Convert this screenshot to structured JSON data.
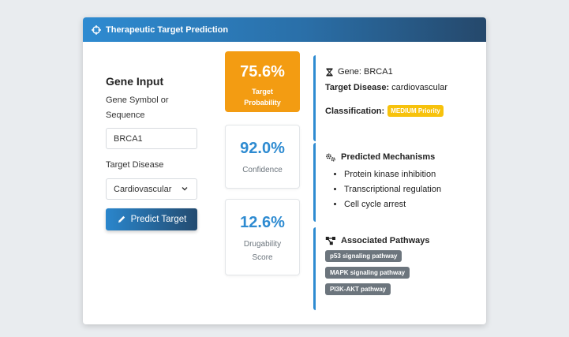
{
  "header": {
    "title": "Therapeutic Target Prediction",
    "icon": "crosshair-icon"
  },
  "input": {
    "title": "Gene Input",
    "symbol_label": "Gene Symbol or Sequence",
    "symbol_value": "BRCA1",
    "disease_label": "Target Disease",
    "disease_value": "Cardiovascular",
    "predict_label": "Predict Target"
  },
  "metrics": [
    {
      "value": "75.6%",
      "label": "Target Probability",
      "color": "#f39c12"
    },
    {
      "value": "92.0%",
      "label": "Confidence",
      "color": "#2e8bd1"
    },
    {
      "value": "12.6%",
      "label": "Drugability Score",
      "color": "#2e8bd1"
    }
  ],
  "target": {
    "gene_text": "Gene: BRCA1",
    "disease_label": "Target Disease:",
    "disease_value": "cardiovascular",
    "classification_label": "Classification:",
    "classification_value": "MEDIUM Priority",
    "badge_color": "#f7c20c"
  },
  "mechanisms": {
    "title": "Predicted Mechanisms",
    "items": [
      "Protein kinase inhibition",
      "Transcriptional regulation",
      "Cell cycle arrest"
    ]
  },
  "pathways": {
    "title": "Associated Pathways",
    "items": [
      "p53 signaling pathway",
      "MAPK signaling pathway",
      "PI3K-AKT pathway"
    ]
  },
  "colors": {
    "accent": "#2e8bd1",
    "header_dark": "#25486b",
    "pill": "#6c757d"
  }
}
